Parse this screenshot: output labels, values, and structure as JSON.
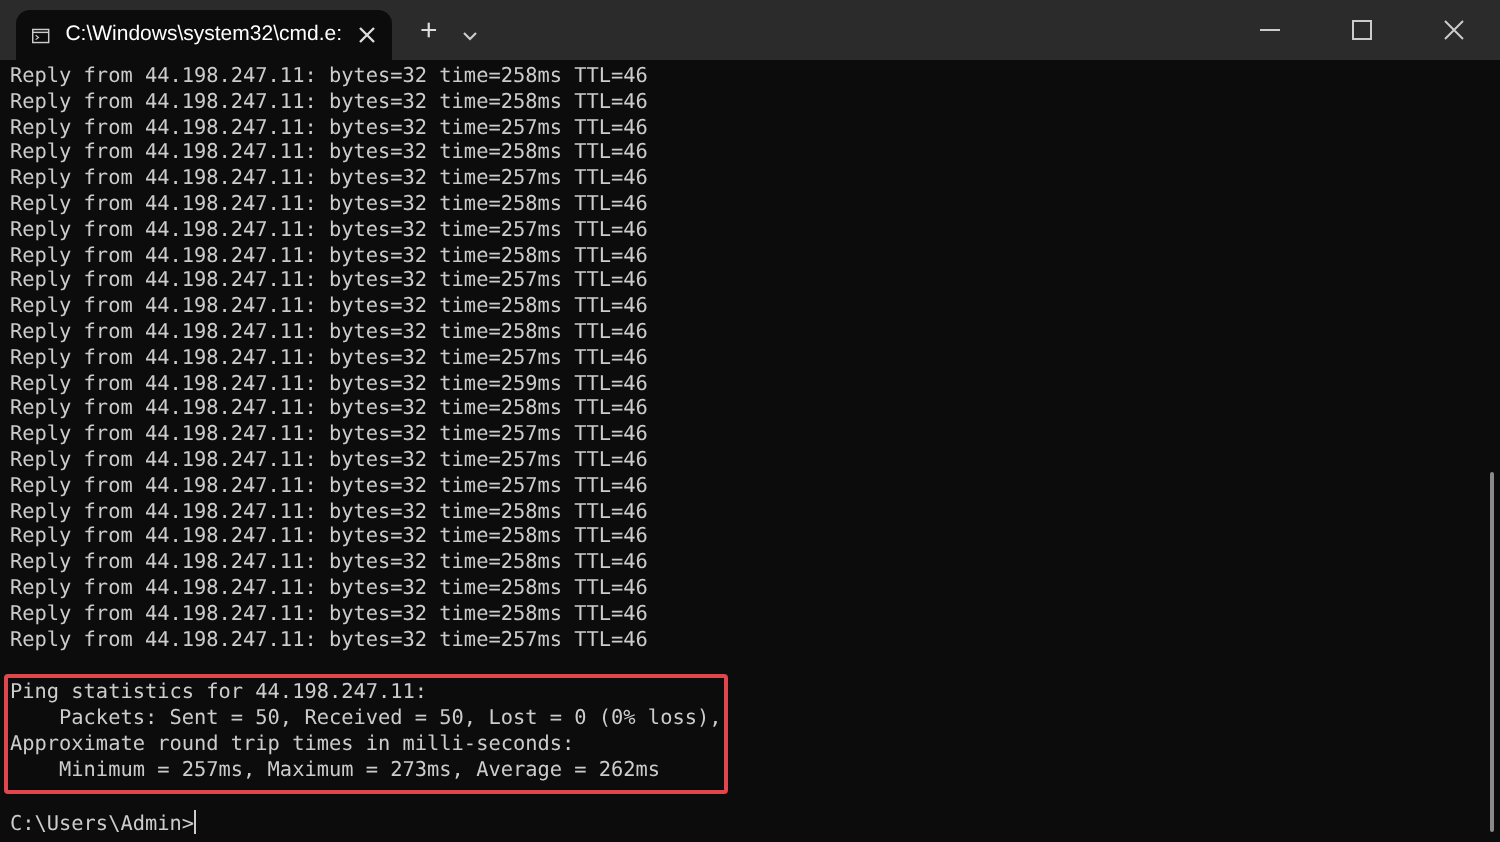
{
  "window": {
    "tab_title": "C:\\Windows\\system32\\cmd.e:",
    "new_tab": "+"
  },
  "output_lines": [
    "Reply from 44.198.247.11: bytes=32 time=258ms TTL=46",
    "Reply from 44.198.247.11: bytes=32 time=258ms TTL=46",
    "Reply from 44.198.247.11: bytes=32 time=257ms TTL=46",
    "Reply from 44.198.247.11: bytes=32 time=258ms TTL=46",
    "Reply from 44.198.247.11: bytes=32 time=257ms TTL=46",
    "Reply from 44.198.247.11: bytes=32 time=258ms TTL=46",
    "Reply from 44.198.247.11: bytes=32 time=257ms TTL=46",
    "Reply from 44.198.247.11: bytes=32 time=258ms TTL=46",
    "Reply from 44.198.247.11: bytes=32 time=257ms TTL=46",
    "Reply from 44.198.247.11: bytes=32 time=258ms TTL=46",
    "Reply from 44.198.247.11: bytes=32 time=258ms TTL=46",
    "Reply from 44.198.247.11: bytes=32 time=257ms TTL=46",
    "Reply from 44.198.247.11: bytes=32 time=259ms TTL=46",
    "Reply from 44.198.247.11: bytes=32 time=258ms TTL=46",
    "Reply from 44.198.247.11: bytes=32 time=257ms TTL=46",
    "Reply from 44.198.247.11: bytes=32 time=257ms TTL=46",
    "Reply from 44.198.247.11: bytes=32 time=257ms TTL=46",
    "Reply from 44.198.247.11: bytes=32 time=258ms TTL=46",
    "Reply from 44.198.247.11: bytes=32 time=258ms TTL=46",
    "Reply from 44.198.247.11: bytes=32 time=258ms TTL=46",
    "Reply from 44.198.247.11: bytes=32 time=258ms TTL=46",
    "Reply from 44.198.247.11: bytes=32 time=258ms TTL=46",
    "Reply from 44.198.247.11: bytes=32 time=257ms TTL=46"
  ],
  "statistics": [
    "Ping statistics for 44.198.247.11:",
    "    Packets: Sent = 50, Received = 50, Lost = 0 (0% loss),",
    "Approximate round trip times in milli-seconds:",
    "    Minimum = 257ms, Maximum = 273ms, Average = 262ms"
  ],
  "prompt": "C:\\Users\\Admin>"
}
